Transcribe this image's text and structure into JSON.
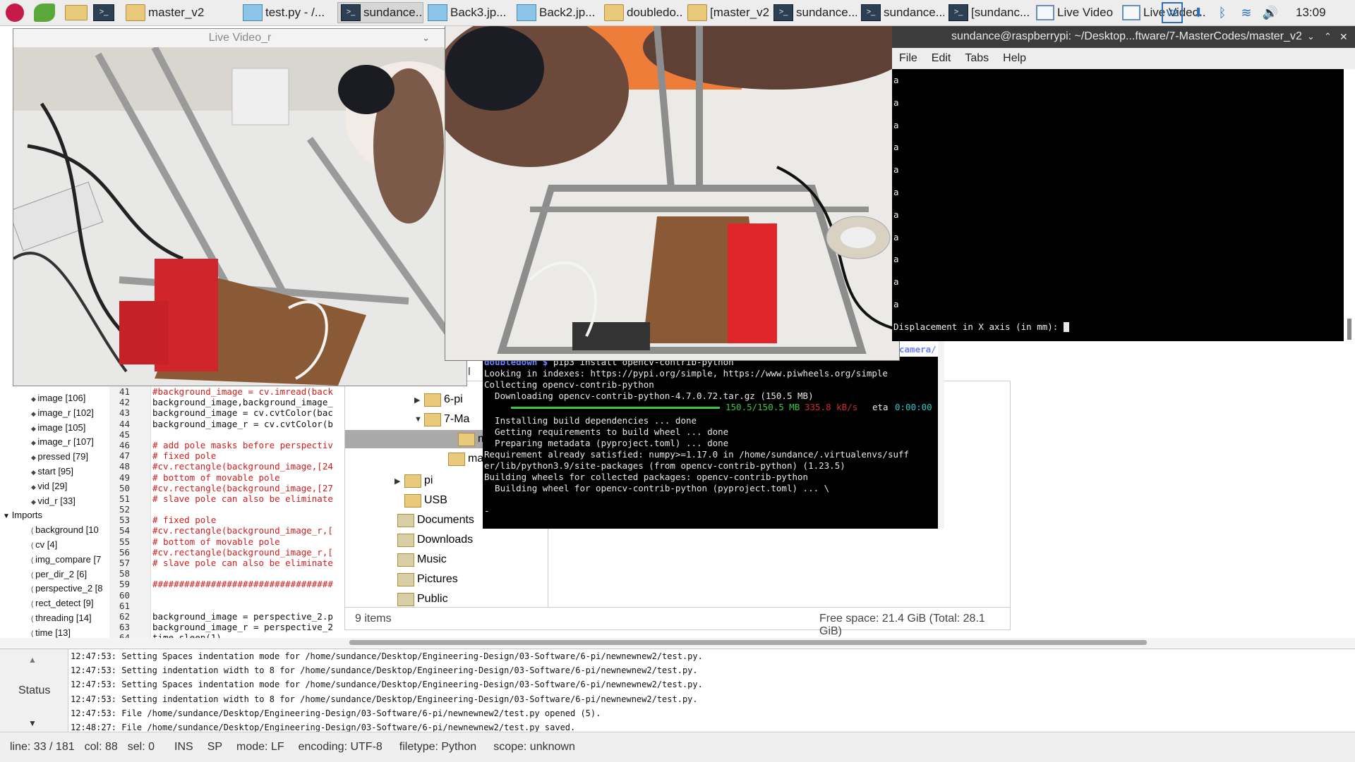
{
  "taskbar": {
    "apps": [
      {
        "label": "master_v2",
        "icon": "folder-icon"
      },
      {
        "label": "test.py - /...",
        "icon": "geany-icon"
      },
      {
        "label": "sundance...",
        "icon": "terminal-icon"
      },
      {
        "label": "Back3.jp...",
        "icon": "image-icon"
      },
      {
        "label": "Back2.jp...",
        "icon": "image-icon"
      },
      {
        "label": "doubledo...",
        "icon": "folder-icon"
      },
      {
        "label": "[master_v2]",
        "icon": "folder-icon"
      },
      {
        "label": "sundance...",
        "icon": "terminal-icon"
      },
      {
        "label": "sundance...",
        "icon": "terminal-icon"
      },
      {
        "label": "[sundanc...",
        "icon": "terminal-icon"
      },
      {
        "label": "Live Video",
        "icon": "window-icon"
      },
      {
        "label": "Live Video...",
        "icon": "window-icon"
      }
    ],
    "clock": "13:09",
    "vnc_label": "V2"
  },
  "video_left": {
    "title": "Live Video_r"
  },
  "terminal": {
    "title": "sundance@raspberrypi: ~/Desktop...ftware/7-MasterCodes/master_v2",
    "menu": [
      "File",
      "Edit",
      "Tabs",
      "Help"
    ],
    "lines": [
      "a",
      "a",
      "a",
      "a",
      "a",
      "a",
      "a",
      "a",
      "a",
      "a",
      "a"
    ],
    "prompt": "Displacement in X axis (in mm): "
  },
  "pip": {
    "path_fragment": "camera/",
    "prompt_user": "doubledown $",
    "prompt_cmd": " pip3 install opencv-contrib-python",
    "lines": [
      "Looking in indexes: https://pypi.org/simple, https://www.piwheels.org/simple",
      "Collecting opencv-contrib-python",
      "  Downloading opencv-contrib-python-4.7.0.72.tar.gz (150.5 MB)"
    ],
    "progress": {
      "done": "150.5/150.5 MB",
      "speed": "335.8 kB/s",
      "eta_label": "eta",
      "eta": "0:00:00",
      "fraction": 1.0
    },
    "lines2": [
      "  Installing build dependencies ... done",
      "  Getting requirements to build wheel ... done",
      "  Preparing metadata (pyproject.toml) ... done",
      "Requirement already satisfied: numpy>=1.17.0 in /home/sundance/.virtualenvs/suff",
      "er/lib/python3.9/site-packages (from opencv-contrib-python) (1.23.5)",
      "Building wheels for collected packages: opencv-contrib-python",
      "  Building wheel for opencv-contrib-python (pyproject.toml) ... \\"
    ],
    "cursor": "-"
  },
  "symbols": {
    "variables": [
      "image [106]",
      "image_r [102]",
      "image [105]",
      "image_r [107]",
      "pressed [79]",
      "start [95]",
      "vid [29]",
      "vid_r [33]"
    ],
    "imports_label": "Imports",
    "imports": [
      "background [10",
      "cv [4]",
      "img_compare [7",
      "per_dir_2 [6]",
      "perspective_2 [8",
      "rect_detect [9]",
      "threading [14]",
      "time [13]"
    ]
  },
  "code": {
    "line_numbers": [
      "41",
      "42",
      "43",
      "44",
      "45",
      "46",
      "47",
      "48",
      "49",
      "50",
      "51",
      "52",
      "53",
      "54",
      "55",
      "56",
      "57",
      "58",
      "59",
      "60",
      "61",
      "62",
      "63",
      "64"
    ],
    "lines": [
      {
        "t": "#background_image = cv.imread(back",
        "c": "cmt"
      },
      {
        "t": "background_image,background_image_",
        "c": "cd"
      },
      {
        "t": "background_image = cv.cvtColor(bac",
        "c": "cd"
      },
      {
        "t": "background_image_r = cv.cvtColor(b",
        "c": "cd"
      },
      {
        "t": "",
        "c": "cd"
      },
      {
        "t": "# add pole masks before perspectiv",
        "c": "cmt"
      },
      {
        "t": "# fixed pole",
        "c": "cmt"
      },
      {
        "t": "#cv.rectangle(background_image,[24",
        "c": "cmt"
      },
      {
        "t": "# bottom of movable pole",
        "c": "cmt"
      },
      {
        "t": "#cv.rectangle(background_image,[27",
        "c": "cmt"
      },
      {
        "t": "# slave pole can also be eliminate",
        "c": "cmt"
      },
      {
        "t": "",
        "c": "cd"
      },
      {
        "t": "# fixed pole",
        "c": "cmt"
      },
      {
        "t": "#cv.rectangle(background_image_r,[",
        "c": "cmt"
      },
      {
        "t": "# bottom of movable pole",
        "c": "cmt"
      },
      {
        "t": "#cv.rectangle(background_image_r,[",
        "c": "cmt"
      },
      {
        "t": "# slave pole can also be eliminate",
        "c": "cmt"
      },
      {
        "t": "",
        "c": "cd"
      },
      {
        "t": "##################################",
        "c": "cmt"
      },
      {
        "t": "",
        "c": "cd"
      },
      {
        "t": "",
        "c": "cd"
      },
      {
        "t": "background_image = perspective_2.p",
        "c": "cd"
      },
      {
        "t": "background_image_r = perspective_2",
        "c": "cd"
      },
      {
        "t": "time.sleep(1)",
        "c": "cd"
      }
    ]
  },
  "file_manager": {
    "tree": [
      {
        "label": "6-pi",
        "arrow": "▶"
      },
      {
        "label": "7-Ma",
        "arrow": "▼"
      },
      {
        "label": "ma",
        "arrow": ""
      },
      {
        "label": "ma",
        "arrow": ""
      },
      {
        "label": "pi",
        "arrow": "▶"
      },
      {
        "label": "USB",
        "arrow": ""
      },
      {
        "label": "Documents",
        "arrow": ""
      },
      {
        "label": "Downloads",
        "arrow": ""
      },
      {
        "label": "Music",
        "arrow": ""
      },
      {
        "label": "Pictures",
        "arrow": ""
      },
      {
        "label": "Public",
        "arrow": ""
      }
    ],
    "side_fragment_1": "",
    "side_fragment_2": "JSI",
    "item_count": "9 items",
    "free_space": "Free space: 21.4 GiB (Total: 28.1 GiB)"
  },
  "status_pane": {
    "tab_label": "Status",
    "log": [
      "12:47:53: Setting Spaces indentation mode for /home/sundance/Desktop/Engineering-Design/03-Software/6-pi/newnewnew2/test.py.",
      "12:47:53: Setting indentation width to 8 for /home/sundance/Desktop/Engineering-Design/03-Software/6-pi/newnewnew2/test.py.",
      "12:47:53: Setting Spaces indentation mode for /home/sundance/Desktop/Engineering-Design/03-Software/6-pi/newnewnew2/test.py.",
      "12:47:53: Setting indentation width to 8 for /home/sundance/Desktop/Engineering-Design/03-Software/6-pi/newnewnew2/test.py.",
      "12:47:53: File /home/sundance/Desktop/Engineering-Design/03-Software/6-pi/newnewnew2/test.py opened (5).",
      "12:48:27: File /home/sundance/Desktop/Engineering-Design/03-Software/6-pi/newnewnew2/test.py saved."
    ]
  },
  "statusbar": {
    "line": "line: 33 / 181",
    "col": "col: 88",
    "sel": "sel: 0",
    "ins": "INS",
    "sp": "SP",
    "mode": "mode: LF",
    "encoding": "encoding: UTF-8",
    "filetype": "filetype: Python",
    "scope": "scope: unknown"
  },
  "colors": {
    "comment": "#d01c1c",
    "terminal_bg": "#000000",
    "progress_green": "#3cc63c",
    "progress_red": "#d02c2c",
    "eta_cyan": "#2cc8c8",
    "prompt_blue": "#6a82ff"
  }
}
